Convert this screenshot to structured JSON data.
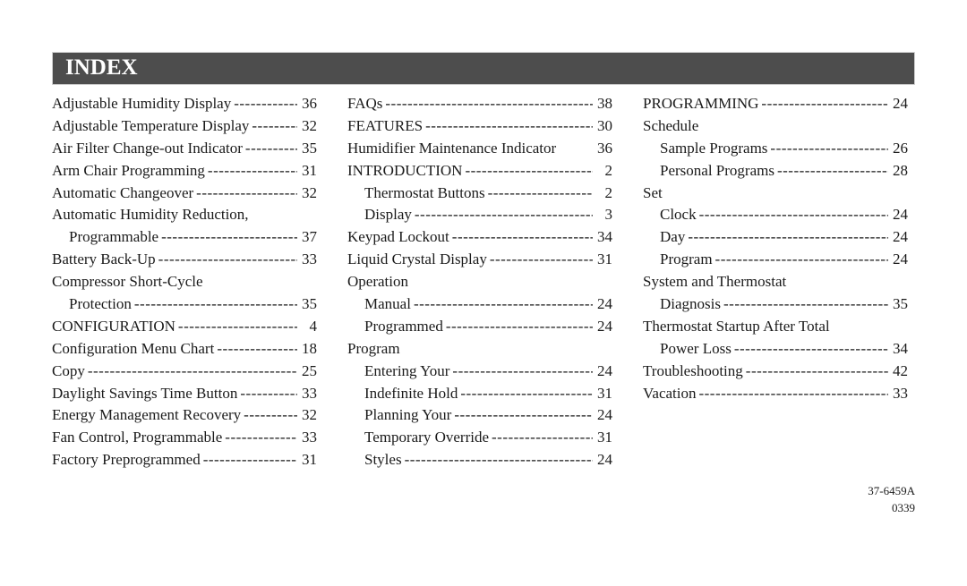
{
  "header": {
    "title": "INDEX"
  },
  "columns": [
    {
      "entries": [
        {
          "label": "Adjustable Humidity Display",
          "page": "36",
          "indent": false,
          "leader": true
        },
        {
          "label": "Adjustable Temperature Display",
          "page": "32",
          "indent": false,
          "leader": true
        },
        {
          "label": "Air Filter Change-out Indicator",
          "page": "35",
          "indent": false,
          "leader": true
        },
        {
          "label": "Arm Chair Programming",
          "page": "31",
          "indent": false,
          "leader": true
        },
        {
          "label": "Automatic Changeover",
          "page": "32",
          "indent": false,
          "leader": true
        },
        {
          "label": "Automatic Humidity Reduction,",
          "page": "",
          "indent": false,
          "leader": false
        },
        {
          "label": "Programmable",
          "page": "37",
          "indent": true,
          "leader": true
        },
        {
          "label": "Battery Back-Up",
          "page": "33",
          "indent": false,
          "leader": true
        },
        {
          "label": "Compressor Short-Cycle",
          "page": "",
          "indent": false,
          "leader": false
        },
        {
          "label": "Protection",
          "page": "35",
          "indent": true,
          "leader": true
        },
        {
          "label": "CONFIGURATION",
          "page": "4",
          "indent": false,
          "leader": true
        },
        {
          "label": "Configuration Menu Chart",
          "page": "18",
          "indent": false,
          "leader": true
        },
        {
          "label": "Copy",
          "page": "25",
          "indent": false,
          "leader": true
        },
        {
          "label": "Daylight Savings Time Button",
          "page": "33",
          "indent": false,
          "leader": true
        },
        {
          "label": "Energy Management Recovery",
          "page": "32",
          "indent": false,
          "leader": true
        },
        {
          "label": "Fan Control, Programmable",
          "page": "33",
          "indent": false,
          "leader": true
        },
        {
          "label": "Factory Preprogrammed",
          "page": "31",
          "indent": false,
          "leader": true
        }
      ]
    },
    {
      "entries": [
        {
          "label": "FAQs",
          "page": "38",
          "indent": false,
          "leader": true
        },
        {
          "label": "FEATURES",
          "page": "30",
          "indent": false,
          "leader": true
        },
        {
          "label": "Humidifier Maintenance Indicator",
          "page": "36",
          "indent": false,
          "leader": false
        },
        {
          "label": "INTRODUCTION",
          "page": "2",
          "indent": false,
          "leader": true
        },
        {
          "label": "Thermostat Buttons",
          "page": "2",
          "indent": true,
          "leader": true
        },
        {
          "label": "Display",
          "page": "3",
          "indent": true,
          "leader": true
        },
        {
          "label": "Keypad Lockout",
          "page": "34",
          "indent": false,
          "leader": true
        },
        {
          "label": "Liquid Crystal Display",
          "page": "31",
          "indent": false,
          "leader": true
        },
        {
          "label": "Operation",
          "page": "",
          "indent": false,
          "leader": false
        },
        {
          "label": "Manual",
          "page": "24",
          "indent": true,
          "leader": true
        },
        {
          "label": "Programmed",
          "page": "24",
          "indent": true,
          "leader": true
        },
        {
          "label": "Program",
          "page": "",
          "indent": false,
          "leader": false
        },
        {
          "label": "Entering Your",
          "page": "24",
          "indent": true,
          "leader": true
        },
        {
          "label": "Indefinite Hold",
          "page": "31",
          "indent": true,
          "leader": true
        },
        {
          "label": "Planning Your",
          "page": "24",
          "indent": true,
          "leader": true
        },
        {
          "label": "Temporary Override",
          "page": "31",
          "indent": true,
          "leader": true
        },
        {
          "label": "Styles",
          "page": "24",
          "indent": true,
          "leader": true
        }
      ]
    },
    {
      "entries": [
        {
          "label": "PROGRAMMING",
          "page": "24",
          "indent": false,
          "leader": true
        },
        {
          "label": "Schedule",
          "page": "",
          "indent": false,
          "leader": false
        },
        {
          "label": "Sample Programs",
          "page": "26",
          "indent": true,
          "leader": true
        },
        {
          "label": "Personal Programs",
          "page": "28",
          "indent": true,
          "leader": true
        },
        {
          "label": "Set",
          "page": "",
          "indent": false,
          "leader": false
        },
        {
          "label": "Clock",
          "page": "24",
          "indent": true,
          "leader": true
        },
        {
          "label": "Day",
          "page": "24",
          "indent": true,
          "leader": true
        },
        {
          "label": "Program",
          "page": "24",
          "indent": true,
          "leader": true
        },
        {
          "label": "System and Thermostat",
          "page": "",
          "indent": false,
          "leader": false
        },
        {
          "label": "Diagnosis",
          "page": "35",
          "indent": true,
          "leader": true
        },
        {
          "label": "Thermostat Startup After Total",
          "page": "",
          "indent": false,
          "leader": false
        },
        {
          "label": "Power Loss",
          "page": "34",
          "indent": true,
          "leader": true
        },
        {
          "label": "Troubleshooting",
          "page": "42",
          "indent": false,
          "leader": true
        },
        {
          "label": "Vacation",
          "page": "33",
          "indent": false,
          "leader": true
        }
      ]
    }
  ],
  "footer": {
    "doc_number": "37-6459A",
    "revision": "0339"
  }
}
